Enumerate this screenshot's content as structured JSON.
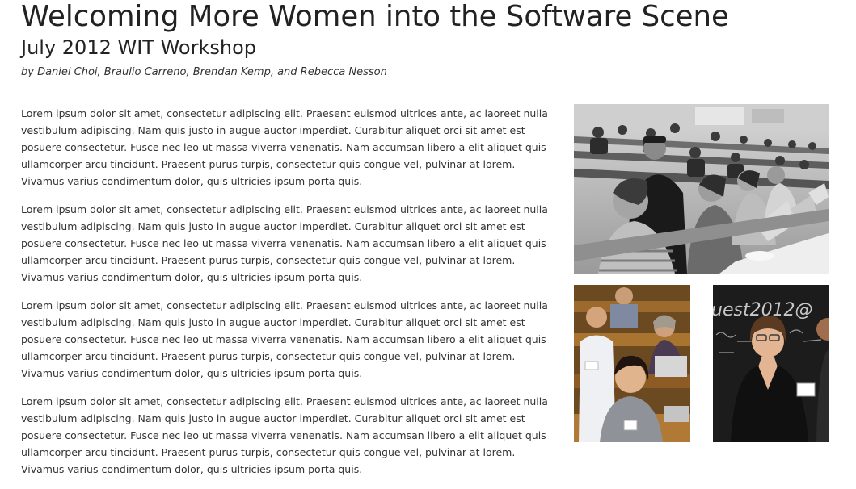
{
  "article": {
    "title": "Welcoming More Women into the Software Scene",
    "subtitle": "July 2012 WIT Workshop",
    "byline": "by Daniel Choi, Braulio Carreno, Brendan Kemp, and Rebecca Nesson",
    "paragraphs": [
      "Lorem ipsum dolor sit amet, consectetur adipiscing elit. Praesent euismod ultrices ante, ac laoreet nulla vestibulum adipiscing. Nam quis justo in augue auctor imperdiet. Curabitur aliquet orci sit amet est posuere consectetur. Fusce nec leo ut massa viverra venenatis. Nam accumsan libero a elit aliquet quis ullamcorper arcu tincidunt. Praesent purus turpis, consectetur quis congue vel, pulvinar at lorem. Vivamus varius condimentum dolor, quis ultricies ipsum porta quis.",
      "Lorem ipsum dolor sit amet, consectetur adipiscing elit. Praesent euismod ultrices ante, ac laoreet nulla vestibulum adipiscing. Nam quis justo in augue auctor imperdiet. Curabitur aliquet orci sit amet est posuere consectetur. Fusce nec leo ut massa viverra venenatis. Nam accumsan libero a elit aliquet quis ullamcorper arcu tincidunt. Praesent purus turpis, consectetur quis congue vel, pulvinar at lorem. Vivamus varius condimentum dolor, quis ultricies ipsum porta quis.",
      "Lorem ipsum dolor sit amet, consectetur adipiscing elit. Praesent euismod ultrices ante, ac laoreet nulla vestibulum adipiscing. Nam quis justo in augue auctor imperdiet. Curabitur aliquet orci sit amet est posuere consectetur. Fusce nec leo ut massa viverra venenatis. Nam accumsan libero a elit aliquet quis ullamcorper arcu tincidunt. Praesent purus turpis, consectetur quis congue vel, pulvinar at lorem. Vivamus varius condimentum dolor, quis ultricies ipsum porta quis.",
      "Lorem ipsum dolor sit amet, consectetur adipiscing elit. Praesent euismod ultrices ante, ac laoreet nulla vestibulum adipiscing. Nam quis justo in augue auctor imperdiet. Curabitur aliquet orci sit amet est posuere consectetur. Fusce nec leo ut massa viverra venenatis. Nam accumsan libero a elit aliquet quis ullamcorper arcu tincidunt. Praesent purus turpis, consectetur quis congue vel, pulvinar at lorem. Vivamus varius condimentum dolor, quis ultricies ipsum porta quis."
    ]
  },
  "photos": {
    "main": {
      "chalkboard_text": ""
    },
    "secondary": {
      "chalkboard_text": "uest2012@"
    }
  },
  "colors": {
    "heading": "#222222",
    "body_text": "#333333",
    "background": "#ffffff"
  }
}
